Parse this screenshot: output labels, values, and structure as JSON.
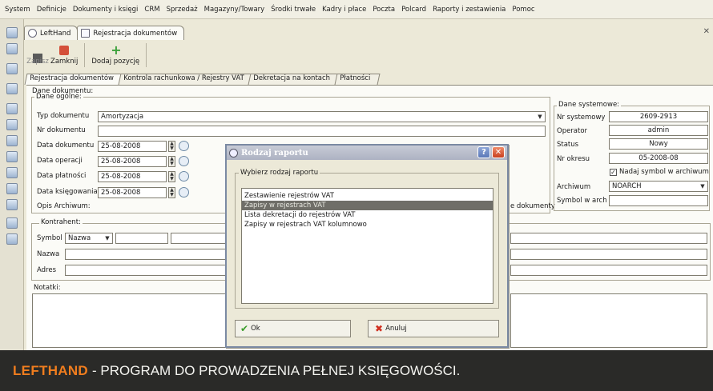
{
  "menubar": [
    "System",
    "Definicje",
    "Dokumenty i księgi",
    "CRM",
    "Sprzedaż",
    "Magazyny/Towary",
    "Środki trwałe",
    "Kadry i płace",
    "Poczta",
    "Polcard",
    "Raporty i zestawienia",
    "Pomoc"
  ],
  "app_tabs": [
    "LeftHand",
    "Rejestracja dokumentów"
  ],
  "toolbar": {
    "save": "Zapisz",
    "close": "Zamknij",
    "add_item": "Dodaj pozycję"
  },
  "subtabs": [
    "Rejestracja dokumentów",
    "Kontrola rachunkowa / Rejestry VAT",
    "Dekretacja na kontach",
    "Płatności"
  ],
  "form": {
    "group_document": "Dane dokumentu:",
    "group_general": "Dane ogólne:",
    "doc_type_label": "Typ dokumentu",
    "doc_type_value": "Amortyzacja",
    "doc_number_label": "Nr dokumentu",
    "doc_date_label": "Data dokumentu",
    "doc_date_value": "25-08-2008",
    "op_date_label": "Data operacji",
    "op_date_value": "25-08-2008",
    "pay_date_label": "Data płatności",
    "pay_date_value": "25-08-2008",
    "book_date_label": "Data księgowania",
    "book_date_value": "25-08-2008",
    "archive_desc_label": "Opis Archiwum:",
    "e_docs_label": "e dokumenty",
    "contractor_group": "Kontrahent:",
    "symbol_label": "Symbol",
    "symbol_select": "Nazwa",
    "name_label": "Nazwa",
    "address_label": "Adres",
    "notes_label": "Notatki:"
  },
  "system": {
    "group": "Dane systemowe:",
    "sys_no_label": "Nr systemowy",
    "sys_no_value": "2609-2913",
    "operator_label": "Operator",
    "operator_value": "admin",
    "status_label": "Status",
    "status_value": "Nowy",
    "period_label": "Nr okresu",
    "period_value": "05-2008-08",
    "archive_check_label": "Nadaj symbol w archiwum",
    "archive_label": "Archiwum",
    "archive_value": "NOARCH",
    "archive_symbol_label": "Symbol w arch"
  },
  "dialog": {
    "title": "Rodzaj raportu",
    "group_caption": "Wybierz rodzaj raportu",
    "items": [
      "Zestawienie rejestrów VAT",
      "Zapisy w rejestrach VAT",
      "Lista dekretacji do rejestrów VAT",
      "Zapisy w rejestrach VAT kolumnowo"
    ],
    "selected_index": 1,
    "ok": "Ok",
    "cancel": "Anuluj"
  },
  "banner": {
    "brand": "LEFTHAND",
    "text": "- PROGRAM DO PROWADZENIA PEŁNEJ KSIĘGOWOŚCI."
  }
}
